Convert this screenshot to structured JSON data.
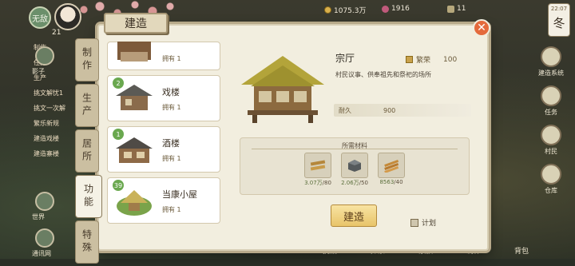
{
  "hud": {
    "badge": "无敌",
    "level": "21",
    "resources": [
      {
        "icon": "coin-icon",
        "value": "1075.3万"
      },
      {
        "icon": "gem-icon",
        "value": "1916"
      },
      {
        "icon": "rice-icon",
        "value": "11"
      }
    ],
    "clock": {
      "time": "22:07",
      "season": "冬"
    }
  },
  "left_hud": {
    "items": [
      "制作",
      "任务",
      "生产",
      "挑文解忧1",
      "挑文一次解",
      "繁乐新规",
      "建造戏楼",
      "建造寨楼"
    ],
    "icons": [
      "影子",
      "世界",
      "通讯网"
    ]
  },
  "right_hud": {
    "items": [
      "建造系统",
      "任务",
      "村民",
      "仓库"
    ]
  },
  "bottom_bar": [
    "挑战",
    "探索",
    "家族",
    "制作",
    "背包"
  ],
  "modal": {
    "title": "建造",
    "categories": [
      {
        "label": "制作",
        "active": false
      },
      {
        "label": "生产",
        "active": false
      },
      {
        "label": "居所",
        "active": false
      },
      {
        "label": "功能",
        "active": true
      },
      {
        "label": "特殊",
        "active": false
      }
    ],
    "buildings": [
      {
        "name": "",
        "owned": "拥有 1",
        "level": ""
      },
      {
        "name": "戏楼",
        "owned": "拥有 1",
        "level": "2"
      },
      {
        "name": "酒楼",
        "owned": "拥有 1",
        "level": "1"
      },
      {
        "name": "当康小屋",
        "owned": "拥有 1",
        "level": "39"
      }
    ],
    "detail": {
      "name": "宗厅",
      "prosperity_label": "繁荣",
      "prosperity_value": "100",
      "description": "村民议事、供奉祖先和祭祀的场所",
      "durability_label": "耐久",
      "durability_value": "900",
      "materials_title": "所需材料",
      "materials": [
        {
          "icon": "wood-plank-icon",
          "have": "3.07万",
          "need": "/80"
        },
        {
          "icon": "stone-block-icon",
          "have": "2.06万",
          "need": "/50"
        },
        {
          "icon": "bamboo-bundle-icon",
          "have": "8563",
          "need": "/40"
        }
      ],
      "build_label": "建造",
      "plan_label": "计划"
    }
  },
  "colors": {
    "modal_bg": "#f2eedf",
    "close": "#e46a3c",
    "build_btn": "#e8c46a",
    "level_badge": "#6aa84f"
  }
}
